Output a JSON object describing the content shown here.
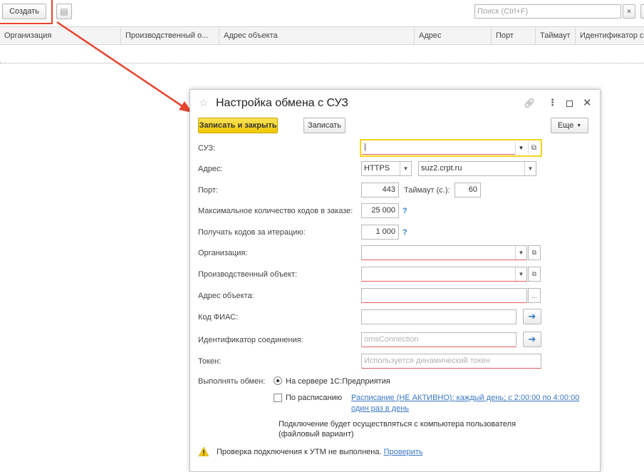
{
  "list": {
    "create_label": "Создать",
    "search_placeholder": "Поиск (Ctrl+F)",
    "search_clear": "×",
    "columns": [
      "Организация",
      "Производственный о...",
      "Адрес объекта",
      "Адрес",
      "Порт",
      "Таймаут",
      "Идентификатор со"
    ]
  },
  "dialog": {
    "title": "Настройка обмена с СУЗ",
    "save_close_label": "Записать и закрыть",
    "save_label": "Записать",
    "more_label": "Еще",
    "fields": {
      "suz_label": "СУЗ:",
      "suz_value": "|",
      "address_label": "Адрес:",
      "protocol_value": "HTTPS",
      "host_value": "suz2.crpt.ru",
      "port_label": "Порт:",
      "port_value": "443",
      "timeout_label": "Таймаут (с.):",
      "timeout_value": "60",
      "max_codes_label": "Максимальное количество кодов в заказе:",
      "max_codes_value": "25 000",
      "codes_per_iter_label": "Получать кодов за итерацию:",
      "codes_per_iter_value": "1 000",
      "org_label": "Организация:",
      "prod_obj_label": "Производственный объект:",
      "obj_address_label": "Адрес объекта:",
      "fias_label": "Код ФИАС:",
      "conn_id_label": "Идентификатор соединения:",
      "conn_id_placeholder": "omsConnection",
      "token_label": "Токен:",
      "token_placeholder": "Используется динамический токен",
      "help_mark": "?"
    },
    "exchange": {
      "label": "Выполнять обмен:",
      "option_server": "На сервере 1С:Предприятия",
      "option_schedule": "По расписанию",
      "schedule_link_line1": "Расписание (НЕ АКТИВНО): каждый день; с 2:00:00 по 4:00:00",
      "schedule_link_line2": "один раз в день",
      "selected": "server"
    },
    "note_line1": "Подключение будет осуществляться с компьютера пользователя",
    "note_line2": "(файловый вариант)",
    "warning_text": "Проверка подключения к УТМ не выполнена.",
    "warning_link": "Проверить"
  },
  "colors": {
    "accent_yellow": "#f5d31f",
    "annotation_red": "#e8432e",
    "link_blue": "#3a78c2",
    "required_underline": "#e06060"
  }
}
